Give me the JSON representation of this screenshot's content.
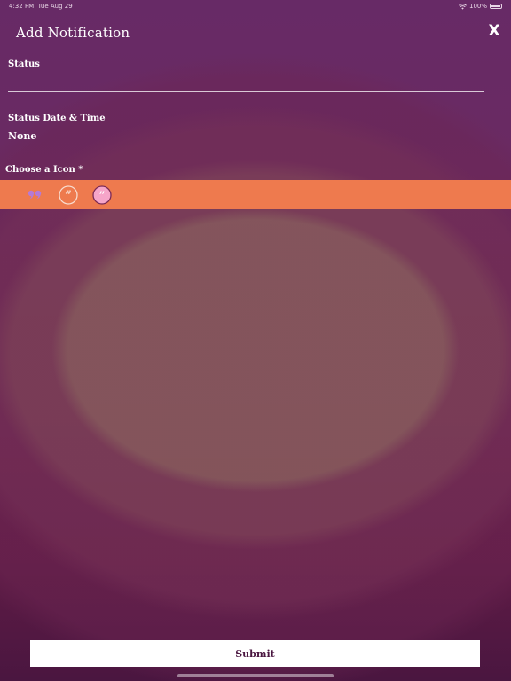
{
  "status_bar": {
    "time": "4:32 PM",
    "date": "Tue Aug 29",
    "battery": "100%",
    "wifi_icon": "wifi-icon",
    "battery_icon": "battery-icon"
  },
  "header": {
    "title": "Add Notification",
    "close_label": "X"
  },
  "form": {
    "status_label": "Status",
    "status_value": "",
    "status_datetime_label": "Status Date & Time",
    "status_datetime_value": "None",
    "icon_label": "Choose a Icon *",
    "icon_options": [
      "quote-purple-icon",
      "quote-circle-outline-icon",
      "quote-circle-pink-icon"
    ]
  },
  "footer": {
    "submit_label": "Submit"
  },
  "colors": {
    "background": "#672a66",
    "icon_bar": "#ee7a4e",
    "accent_pink": "#f6a5c9",
    "accent_purple": "#b57ad7"
  }
}
